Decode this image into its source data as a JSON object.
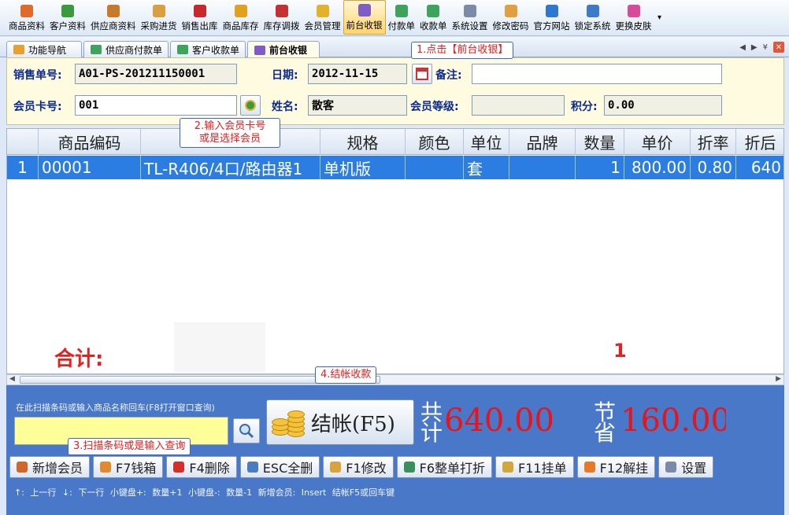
{
  "toolbar": {
    "items": [
      {
        "label": "商品资料",
        "icon": "product-icon",
        "color": "#e06a2b"
      },
      {
        "label": "客户资料",
        "icon": "customer-icon",
        "color": "#3b9a3b"
      },
      {
        "label": "供应商资料",
        "icon": "supplier-icon",
        "color": "#c77a2a"
      },
      {
        "label": "采购进货",
        "icon": "purchase-icon",
        "color": "#d8a040"
      },
      {
        "label": "销售出库",
        "icon": "sales-out-icon",
        "color": "#c8282d"
      },
      {
        "label": "商品库存",
        "icon": "inventory-icon",
        "color": "#e0a020"
      },
      {
        "label": "库存调拨",
        "icon": "transfer-icon",
        "color": "#c53030"
      },
      {
        "label": "会员管理",
        "icon": "member-icon",
        "color": "#e3b22c"
      },
      {
        "label": "前台收银",
        "icon": "cashier-icon",
        "color": "#7f5cc6"
      },
      {
        "label": "付款单",
        "icon": "payment-icon",
        "color": "#3da35d"
      },
      {
        "label": "收款单",
        "icon": "receipt-icon",
        "color": "#3da35d"
      },
      {
        "label": "系统设置",
        "icon": "settings-icon",
        "color": "#7a8aa8"
      },
      {
        "label": "修改密码",
        "icon": "password-icon",
        "color": "#e0a040"
      },
      {
        "label": "官方网站",
        "icon": "web-icon",
        "color": "#2f78d0"
      },
      {
        "label": "锁定系统",
        "icon": "lock-icon",
        "color": "#3d7bc8"
      },
      {
        "label": "更换皮肤",
        "icon": "skin-icon",
        "color": "#d84a9a"
      }
    ]
  },
  "tabs": [
    {
      "label": "功能导航",
      "color": "#e8a030"
    },
    {
      "label": "供应商付款单",
      "color": "#3da35d"
    },
    {
      "label": "客户收款单",
      "color": "#3da35d"
    },
    {
      "label": "前台收银",
      "color": "#7f5cc6"
    }
  ],
  "form": {
    "order_no_label": "销售单号:",
    "order_no": "A01-PS-201211150001",
    "date_label": "日期:",
    "date": "2012-11-15",
    "remark_label": "备注:",
    "remark": "",
    "card_label": "会员卡号:",
    "card": "001",
    "name_label": "姓名:",
    "name": "散客",
    "level_label": "会员等级:",
    "level": "",
    "points_label": "积分:",
    "points": "0.00"
  },
  "grid": {
    "headers": [
      "",
      "商品编码",
      "",
      "规格",
      "颜色",
      "单位",
      "品牌",
      "数量",
      "单价",
      "折率",
      "折后"
    ],
    "rows": [
      {
        "idx": "1",
        "code": "00001",
        "name": "TL-R406/4口/路由器1",
        "spec": "单机版",
        "color": "",
        "unit": "套",
        "brand": "",
        "qty": "1",
        "price": "800.00",
        "rate": "0.80",
        "after": "640"
      }
    ],
    "total_label": "合计:",
    "total_count": "1"
  },
  "bottom": {
    "scan_hint": "在此扫描条码或输入商品名称回车(F8打开窗口查询)",
    "scan_value": "",
    "pay_button": "结帐(F5)",
    "total_label": "共计",
    "total_value": "640.00",
    "save_label": "节省",
    "save_value": "160.00",
    "fkeys": [
      {
        "label": "新增会员",
        "color": "#d1662a"
      },
      {
        "label": "F7钱箱",
        "color": "#e08a2c"
      },
      {
        "label": "F4删除",
        "color": "#d3302a"
      },
      {
        "label": "ESC全删",
        "color": "#4b7cc0"
      },
      {
        "label": "F1修改",
        "color": "#d9a23a"
      },
      {
        "label": "F6整单打折",
        "color": "#3b8f5a"
      },
      {
        "label": "F11挂单",
        "color": "#d1a63a"
      },
      {
        "label": "F12解挂",
        "color": "#e57a2a"
      },
      {
        "label": "设置",
        "color": "#7a8aa8"
      }
    ],
    "status": "↑: 上一行   ↓: 下一行   小键盘+: 数量+1   小键盘-: 数量-1   新增会员: Insert   结帐F5或回车键"
  },
  "callouts": {
    "c1": "1.点击【前台收银】",
    "c2a": "2.输入会员卡号",
    "c2b": "或是选择会员",
    "c3": "3.扫描条码或是输入查询",
    "c4": "4.结帐收款"
  }
}
